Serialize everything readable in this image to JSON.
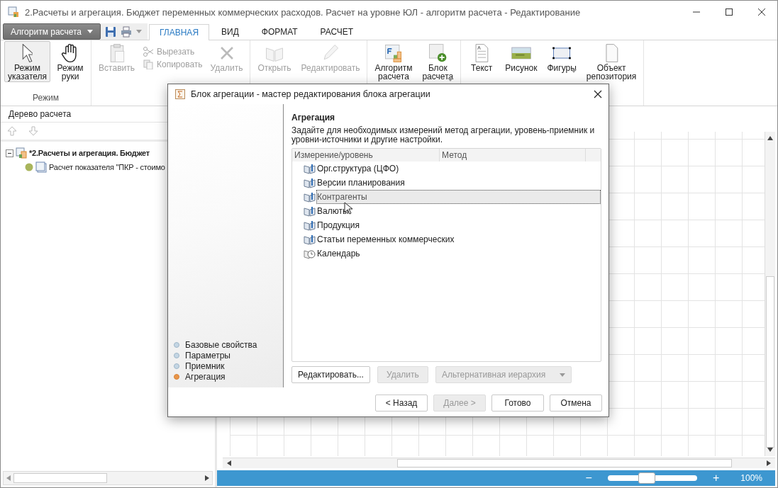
{
  "window": {
    "title": "2.Расчеты и агрегация. Бюджет переменных коммерческих расходов. Расчет на уровне ЮЛ  - алгоритм расчета - Редактирование"
  },
  "app_menu": {
    "label": "Алгоритм расчета"
  },
  "ribbon_tabs": [
    {
      "label": "ГЛАВНАЯ",
      "selected": true
    },
    {
      "label": "ВИД",
      "selected": false
    },
    {
      "label": "ФОРМАТ",
      "selected": false
    },
    {
      "label": "РАСЧЕТ",
      "selected": false
    }
  ],
  "ribbon": {
    "groups": [
      {
        "label": "Режим",
        "items": [
          {
            "kind": "large",
            "label": "Режим указателя",
            "selected": true,
            "disabled": false,
            "dropdown": false
          },
          {
            "kind": "large",
            "label": "Режим руки",
            "selected": false,
            "disabled": false,
            "dropdown": false
          }
        ]
      },
      {
        "items": [
          {
            "kind": "large",
            "label": "Вставить",
            "disabled": true,
            "dropdown": false
          },
          {
            "kind": "small",
            "label": "Вырезать",
            "disabled": true
          },
          {
            "kind": "small",
            "label": "Копировать",
            "disabled": true
          },
          {
            "kind": "large",
            "label": "Удалить",
            "disabled": true,
            "dropdown": false
          }
        ]
      },
      {
        "items": [
          {
            "kind": "large",
            "label": "Открыть",
            "disabled": true,
            "dropdown": false
          },
          {
            "kind": "large",
            "label": "Редактировать",
            "disabled": true,
            "dropdown": false
          }
        ]
      },
      {
        "items": [
          {
            "kind": "large",
            "label": "Алгоритм расчета",
            "disabled": false,
            "dropdown": false
          },
          {
            "kind": "large",
            "label": "Блок расчета",
            "disabled": false,
            "dropdown": true
          }
        ]
      },
      {
        "items": [
          {
            "kind": "large",
            "label": "Текст",
            "disabled": false,
            "dropdown": false
          },
          {
            "kind": "large",
            "label": "Рисунок",
            "disabled": false,
            "dropdown": false
          },
          {
            "kind": "large",
            "label": "Фигуры",
            "disabled": false,
            "dropdown": true
          },
          {
            "kind": "large",
            "label": "Объект репозитория",
            "disabled": false,
            "dropdown": false
          }
        ]
      }
    ]
  },
  "tree_panel": {
    "title": "Дерево расчета",
    "nodes": [
      {
        "label": "*2.Расчеты и агрегация. Бюджет",
        "expanded": true,
        "children": [
          {
            "label": "Расчет показателя \"ПКР - стоимо"
          }
        ]
      }
    ]
  },
  "dialog": {
    "title": "Блок агрегации - мастер редактирования блока агрегации",
    "steps": [
      {
        "label": "Базовые свойства",
        "selected": false
      },
      {
        "label": "Параметры",
        "selected": false
      },
      {
        "label": "Приемник",
        "selected": false
      },
      {
        "label": "Агрегация",
        "selected": true
      }
    ],
    "heading": "Агрегация",
    "description": "Задайте для необходимых измерений метод агрегации, уровень-приемник и уровни-источники и другие настройки.",
    "table": {
      "columns": [
        "Измерение/уровень",
        "Метод"
      ],
      "rows": [
        {
          "kind": "dimension",
          "label": "Орг.структура (ЦФО)",
          "selected": false
        },
        {
          "kind": "dimension",
          "label": "Версии планирования",
          "selected": false
        },
        {
          "kind": "dimension",
          "label": "Контрагенты",
          "selected": true
        },
        {
          "kind": "dimension",
          "label": "Валюты",
          "selected": false
        },
        {
          "kind": "dimension",
          "label": "Продукция",
          "selected": false
        },
        {
          "kind": "dimension",
          "label": "Статьи переменных коммерческих",
          "selected": false
        },
        {
          "kind": "calendar",
          "label": "Календарь",
          "selected": false
        }
      ]
    },
    "actions": [
      {
        "label": "Редактировать...",
        "disabled": false,
        "dropdown": false
      },
      {
        "label": "Удалить",
        "disabled": true,
        "dropdown": false
      },
      {
        "label": "Альтернативная иерархия",
        "disabled": true,
        "dropdown": true
      }
    ],
    "nav_buttons": [
      {
        "label": "< Назад",
        "disabled": false
      },
      {
        "label": "Далее >",
        "disabled": true
      },
      {
        "label": "Готово",
        "disabled": false
      },
      {
        "label": "Отмена",
        "disabled": false
      }
    ]
  },
  "status_bar": {
    "zoom_out": "−",
    "zoom_in": "+",
    "zoom": {
      "level": 0.43
    },
    "zoom_label": "100%"
  }
}
